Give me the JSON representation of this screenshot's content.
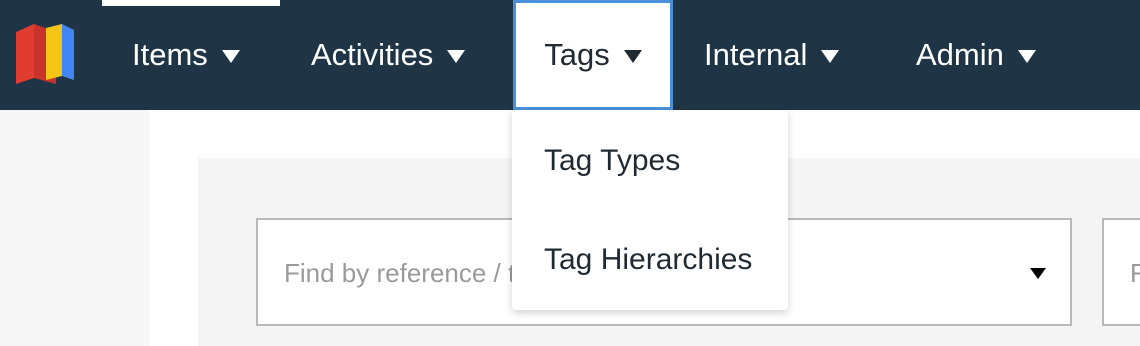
{
  "nav": {
    "items": [
      {
        "label": "Items"
      },
      {
        "label": "Activities"
      },
      {
        "label": "Tags"
      },
      {
        "label": "Internal"
      },
      {
        "label": "Admin"
      }
    ]
  },
  "tags_menu": {
    "items": [
      {
        "label": "Tag Types"
      },
      {
        "label": "Tag Hierarchies"
      }
    ]
  },
  "filters": {
    "reference_placeholder": "Find by reference / title",
    "second_placeholder": "Find"
  },
  "colors": {
    "navbar": "#1f3545",
    "active_border": "#4a90d9",
    "logo_red": "#e03c31",
    "logo_yellow": "#f5c518",
    "logo_blue": "#4285f4"
  }
}
